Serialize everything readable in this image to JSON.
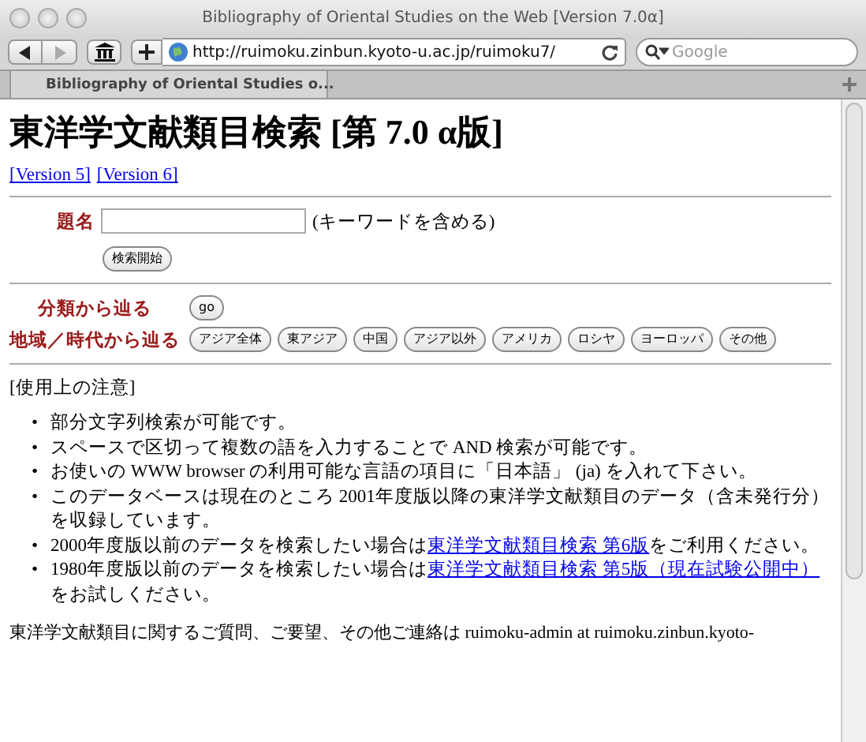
{
  "window": {
    "title": "Bibliography of Oriental Studies on the Web [Version 7.0α]"
  },
  "toolbar": {
    "url": "http://ruimoku.zinbun.kyoto-u.ac.jp/ruimoku7/",
    "search": {
      "placeholder": "Google"
    }
  },
  "tabs": [
    {
      "label": "Bibliography of Oriental Studies o...",
      "selected": true
    }
  ],
  "page": {
    "heading": "東洋学文献類目検索 [第 7.0 α版]",
    "version_links": [
      "[Version 5]",
      "[Version 6]"
    ],
    "title_search": {
      "label": "題名",
      "hint": "(キーワードを含める)",
      "button": "検索開始"
    },
    "browse": [
      {
        "label": "分類から辿る",
        "buttons": [
          "go"
        ]
      },
      {
        "label": "地域／時代から辿る",
        "buttons": [
          "アジア全体",
          "東アジア",
          "中国",
          "アジア以外",
          "アメリカ",
          "ロシヤ",
          "ヨーロッパ",
          "その他"
        ]
      }
    ],
    "notes_title": "[使用上の注意]",
    "notes": [
      {
        "marker": "•",
        "parts": [
          {
            "kind": "text",
            "text": "部分文字列検索が可能です。"
          }
        ]
      },
      {
        "marker": "•",
        "parts": [
          {
            "kind": "text",
            "text": "スペースで区切って複数の語を入力することで AND 検索が可能です。"
          }
        ]
      },
      {
        "marker": "•",
        "parts": [
          {
            "kind": "text",
            "text": "お使いの WWW browser の利用可能な言語の項目に「日本語」 (ja) を入れて下さい。"
          }
        ]
      },
      {
        "marker": "•",
        "parts": [
          {
            "kind": "text",
            "text": "このデータベースは現在のところ 2001年度版以降の東洋学文献類目のデータ（含未発行分）を収録しています。"
          }
        ]
      },
      {
        "marker": "•",
        "parts": [
          {
            "kind": "text",
            "text": "2000年度版以前のデータを検索したい場合は"
          },
          {
            "kind": "link",
            "text": "東洋学文献類目検索 第6版"
          },
          {
            "kind": "text",
            "text": "をご利用ください。"
          }
        ]
      },
      {
        "marker": "•",
        "parts": [
          {
            "kind": "text",
            "text": "1980年度版以前のデータを検索したい場合は"
          },
          {
            "kind": "link",
            "text": "東洋学文献類目検索 第5版（現在試験公開中）"
          },
          {
            "kind": "text",
            "text": "をお試しください。"
          }
        ]
      }
    ],
    "contact": "東洋学文献類目に関するご質問、ご要望、その他ご連絡は ruimoku-admin at ruimoku.zinbun.kyoto-"
  }
}
